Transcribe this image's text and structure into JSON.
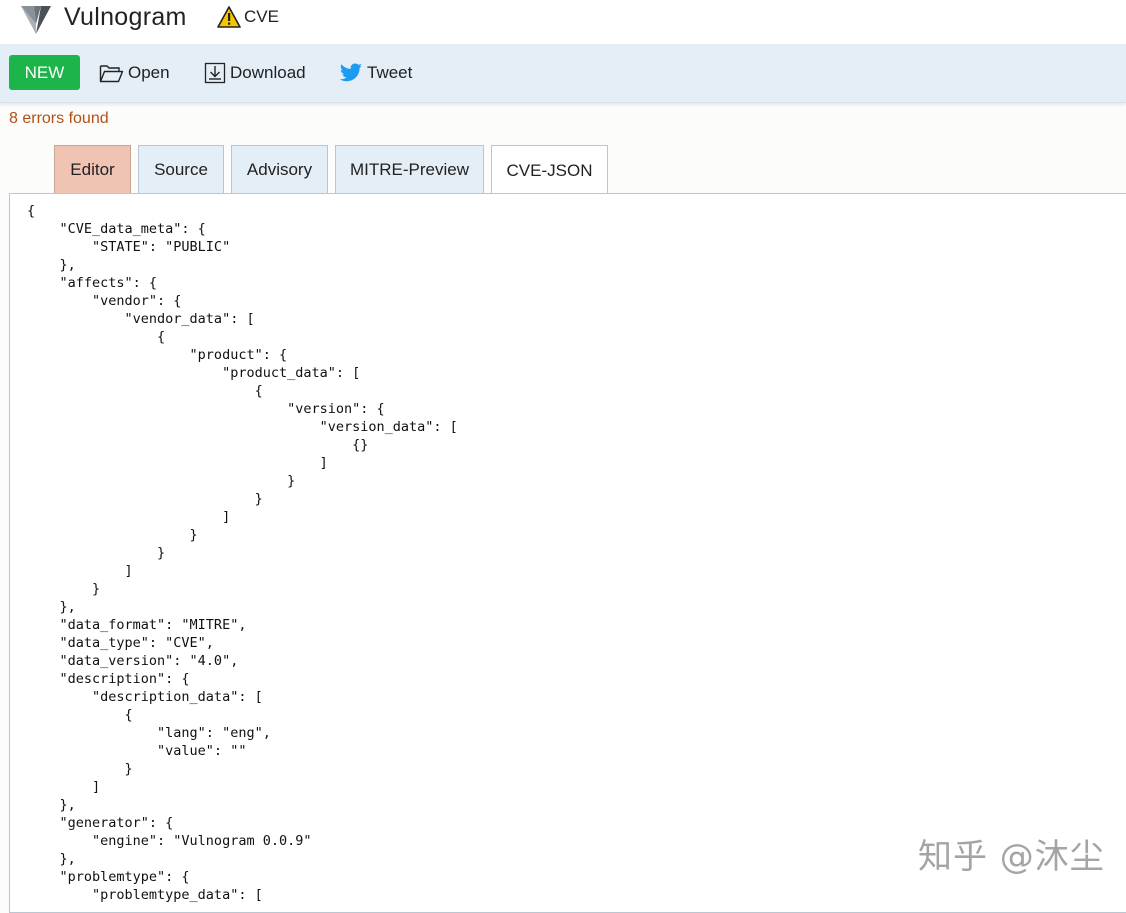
{
  "app": {
    "title": "Vulnogram",
    "badge_label": "CVE",
    "badge_icon": "warning-icon"
  },
  "toolbar": {
    "new_label": "NEW",
    "open_label": "Open",
    "download_label": "Download",
    "tweet_label": "Tweet",
    "new_color": "#1db44a"
  },
  "status": {
    "errors_text": "8 errors found",
    "errors_color": "#b1501a"
  },
  "tabs": [
    {
      "label": "Editor"
    },
    {
      "label": "Source"
    },
    {
      "label": "Advisory"
    },
    {
      "label": "MITRE-Preview"
    },
    {
      "label": "CVE-JSON",
      "active": true
    }
  ],
  "json_view": {
    "lines": [
      "{",
      "    \"CVE_data_meta\": {",
      "        \"STATE\": \"PUBLIC\"",
      "    },",
      "    \"affects\": {",
      "        \"vendor\": {",
      "            \"vendor_data\": [",
      "                {",
      "                    \"product\": {",
      "                        \"product_data\": [",
      "                            {",
      "                                \"version\": {",
      "                                    \"version_data\": [",
      "                                        {}",
      "                                    ]",
      "                                }",
      "                            }",
      "                        ]",
      "                    }",
      "                }",
      "            ]",
      "        }",
      "    },",
      "    \"data_format\": \"MITRE\",",
      "    \"data_type\": \"CVE\",",
      "    \"data_version\": \"4.0\",",
      "    \"description\": {",
      "        \"description_data\": [",
      "            {",
      "                \"lang\": \"eng\",",
      "                \"value\": \"\"",
      "            }",
      "        ]",
      "    },",
      "    \"generator\": {",
      "        \"engine\": \"Vulnogram 0.0.9\"",
      "    },",
      "    \"problemtype\": {",
      "        \"problemtype_data\": ["
    ]
  },
  "watermark": "知乎 @沐尘"
}
